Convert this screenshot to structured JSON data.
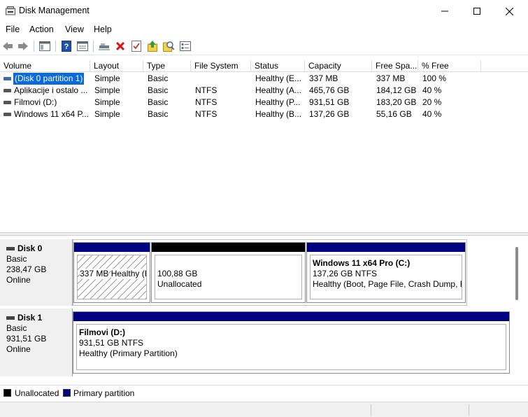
{
  "window": {
    "title": "Disk Management"
  },
  "menu": [
    "File",
    "Action",
    "View",
    "Help"
  ],
  "toolbar": {
    "icons": [
      "back-icon",
      "forward-icon",
      "show-hide-console-tree-icon",
      "help-icon",
      "properties-icon",
      "connect-icon",
      "delete-icon",
      "check-icon",
      "import-icon",
      "rescan-icon",
      "settings-icon"
    ]
  },
  "volume_table": {
    "columns": [
      "Volume",
      "Layout",
      "Type",
      "File System",
      "Status",
      "Capacity",
      "Free Spa...",
      "% Free"
    ],
    "rows": [
      {
        "volume": "(Disk 0 partition 1)",
        "layout": "Simple",
        "type": "Basic",
        "fs": "",
        "status": "Healthy (E...",
        "capacity": "337 MB",
        "free": "337 MB",
        "pct": "100 %"
      },
      {
        "volume": "Aplikacije i ostalo ...",
        "layout": "Simple",
        "type": "Basic",
        "fs": "NTFS",
        "status": "Healthy (A...",
        "capacity": "465,76 GB",
        "free": "184,12 GB",
        "pct": "40 %"
      },
      {
        "volume": "Filmovi (D:)",
        "layout": "Simple",
        "type": "Basic",
        "fs": "NTFS",
        "status": "Healthy (P...",
        "capacity": "931,51 GB",
        "free": "183,20 GB",
        "pct": "20 %"
      },
      {
        "volume": "Windows 11 x64 P...",
        "layout": "Simple",
        "type": "Basic",
        "fs": "NTFS",
        "status": "Healthy (B...",
        "capacity": "137,26 GB",
        "free": "55,16 GB",
        "pct": "40 %"
      }
    ]
  },
  "disks": [
    {
      "name": "Disk 0",
      "type": "Basic",
      "size": "238,47 GB",
      "state": "Online",
      "partitions": [
        {
          "title": "",
          "size": "337 MB",
          "status": "Healthy (EFI System Partition)",
          "kind": "primary",
          "hatched": true
        },
        {
          "title": "",
          "size": "100,88 GB",
          "status": "Unallocated",
          "kind": "unallocated",
          "hatched": false
        },
        {
          "title": "Windows 11 x64 Pro  (C:)",
          "size": "137,26 GB NTFS",
          "status": "Healthy (Boot, Page File, Crash Dump, Basic Data Partition)",
          "kind": "primary",
          "hatched": false
        }
      ]
    },
    {
      "name": "Disk 1",
      "type": "Basic",
      "size": "931,51 GB",
      "state": "Online",
      "partitions": [
        {
          "title": "Filmovi  (D:)",
          "size": "931,51 GB NTFS",
          "status": "Healthy (Primary Partition)",
          "kind": "primary",
          "hatched": false
        }
      ]
    }
  ],
  "legend": [
    {
      "label": "Unallocated",
      "color": "#000000"
    },
    {
      "label": "Primary partition",
      "color": "#000080"
    }
  ],
  "colors": {
    "primary": "#000080",
    "unallocated": "#000000",
    "selection": "#0a6ad8"
  }
}
